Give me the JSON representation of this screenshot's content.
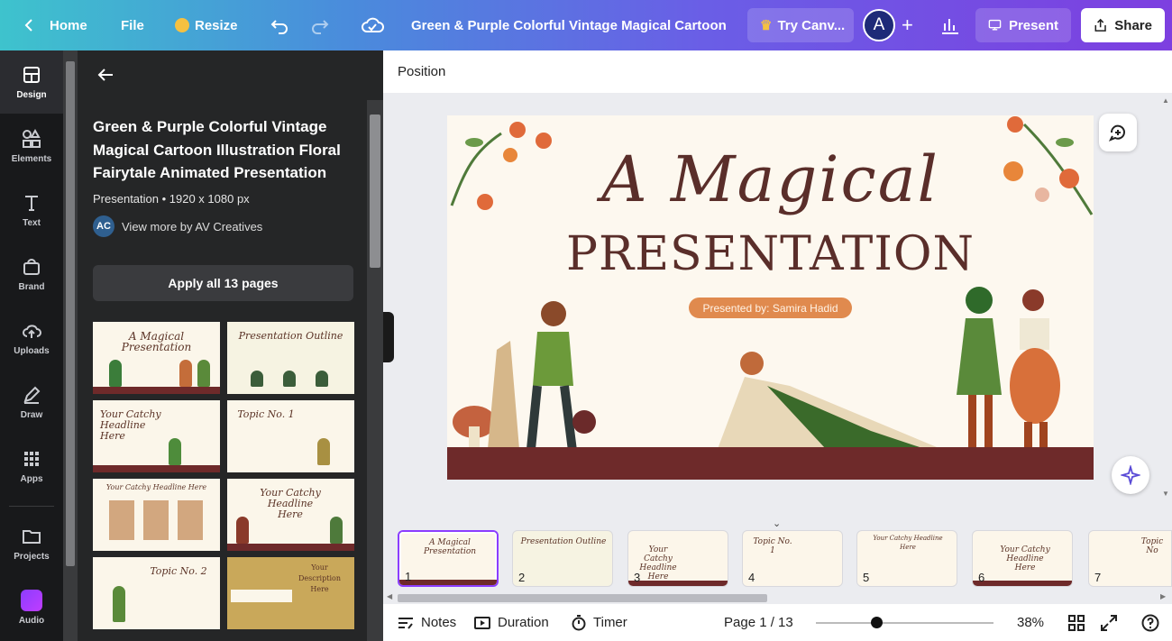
{
  "topbar": {
    "home": "Home",
    "file": "File",
    "resize": "Resize",
    "doc_title": "Green & Purple Colorful Vintage Magical Cartoon I...",
    "try_canva": "Try Canv...",
    "avatar_letter": "A",
    "present": "Present",
    "share": "Share"
  },
  "rail": {
    "items": [
      "Design",
      "Elements",
      "Text",
      "Brand",
      "Uploads",
      "Draw",
      "Apps",
      "Projects",
      "Audio"
    ]
  },
  "panel": {
    "title": "Green & Purple Colorful Vintage Magical Cartoon Illustration Floral Fairytale Animated Presentation",
    "meta": "Presentation • 1920 x 1080 px",
    "author_initials": "AC",
    "author": "View more by AV Creatives",
    "apply": "Apply all 13 pages",
    "thumbs": [
      "A Magical Presentation",
      "Presentation Outline",
      "Your Catchy Headline Here",
      "Topic No. 1",
      "Your Catchy Headline Here",
      "Your Catchy Headline Here",
      "Topic No. 2",
      "Your Description Here"
    ]
  },
  "editor": {
    "position": "Position",
    "slide": {
      "title_line1": "A Magical",
      "title_line2": "PRESENTATION",
      "presenter": "Presented by: Samira Hadid"
    },
    "filmstrip": [
      {
        "num": "1",
        "title": "A Magical Presentation"
      },
      {
        "num": "2",
        "title": "Presentation Outline"
      },
      {
        "num": "3",
        "title": "Your Catchy Headline Here"
      },
      {
        "num": "4",
        "title": "Topic No. 1"
      },
      {
        "num": "5",
        "title": "Your Catchy Headline Here"
      },
      {
        "num": "6",
        "title": "Your Catchy Headline Here"
      },
      {
        "num": "7",
        "title": "Topic No"
      }
    ]
  },
  "bottombar": {
    "notes": "Notes",
    "duration": "Duration",
    "timer": "Timer",
    "page": "Page 1 / 13",
    "zoom": "38%"
  },
  "colors": {
    "accent": "#8b3dff",
    "slide_bg": "#fdf8ef",
    "slide_text": "#5a2e2a",
    "ground": "#6e2a2a"
  }
}
